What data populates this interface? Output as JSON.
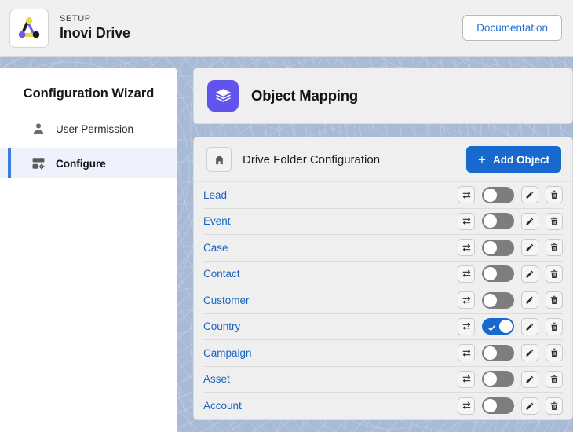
{
  "header": {
    "eyebrow": "SETUP",
    "title": "Inovi Drive",
    "logo_icon": "inovi-triad-logo-icon",
    "documentation_label": "Documentation"
  },
  "sidebar": {
    "title": "Configuration Wizard",
    "items": [
      {
        "label": "User Permission",
        "icon": "user-icon",
        "active": false
      },
      {
        "label": "Configure",
        "icon": "server-gear-icon",
        "active": true
      }
    ]
  },
  "main": {
    "panel": {
      "title": "Object Mapping",
      "icon": "layers-stack-icon"
    },
    "config": {
      "home_icon": "home-icon",
      "title": "Drive Folder Configuration",
      "add_button_label": "Add Object",
      "add_button_plus": "+",
      "row_icons": {
        "sync": "sync-swap-arrows-icon",
        "edit": "pencil-edit-icon",
        "delete": "trash-delete-icon"
      },
      "rows": [
        {
          "name": "Lead",
          "enabled": false
        },
        {
          "name": "Event",
          "enabled": false
        },
        {
          "name": "Case",
          "enabled": false
        },
        {
          "name": "Contact",
          "enabled": false
        },
        {
          "name": "Customer",
          "enabled": false
        },
        {
          "name": "Country",
          "enabled": true
        },
        {
          "name": "Campaign",
          "enabled": false
        },
        {
          "name": "Asset",
          "enabled": false
        },
        {
          "name": "Account",
          "enabled": false
        }
      ]
    }
  },
  "colors": {
    "accent_blue": "#1769cd",
    "link_blue": "#1b64c4",
    "panel_purple": "#6154ec",
    "background_blue": "#a9bad7",
    "active_nav_bar": "#3b7ddd"
  }
}
